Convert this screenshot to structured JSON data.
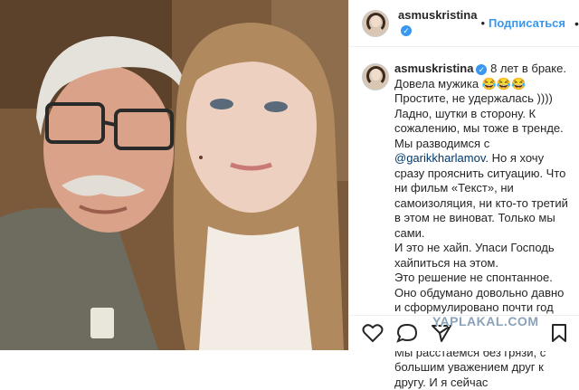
{
  "post": {
    "username": "asmuskristina",
    "follow_label": "Подписаться",
    "caption_lead": "8 лет в браке.",
    "caption_part1": "Довела мужика 😂😂😂 Простите, не удержалась )))) Ладно, шутки в сторону. К сожалению, мы тоже в тренде. Мы разводимся с",
    "mention": "@garikkharlamov",
    "caption_part2": ". Но я хочу сразу прояснить ситуацию. Что ни фильм «Текст», ни самоизоляция, ни кто-то третий в этом не виноват. Только мы сами.\nИ это не хайп. Упаси Господь хайпиться на этом.\nЭто решение не спонтанное. Оно обдумано довольно давно и сформулировано почти год назад. До того как это стало мейнстримом )))))\nМы расстаёмся без грязи, с большим уважением друг к другу. И я сейчас"
  },
  "watermark": "YAPLAKAL.COM",
  "icons": [
    "more-options-icon",
    "verified-badge-icon",
    "heart-icon",
    "comment-icon",
    "share-icon",
    "bookmark-icon"
  ]
}
